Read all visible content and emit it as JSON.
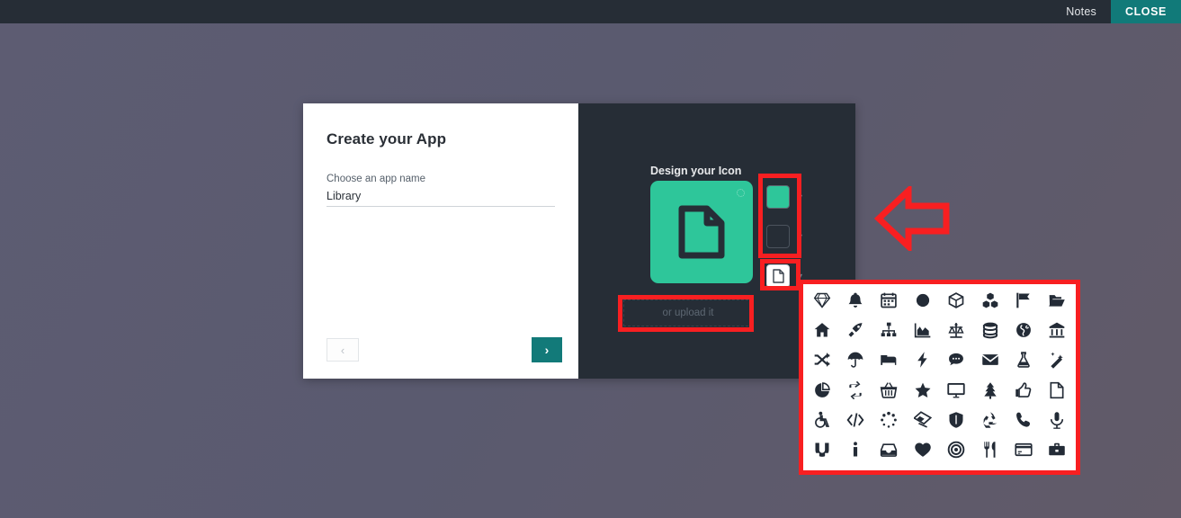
{
  "topbar": {
    "notes_label": "Notes",
    "close_label": "CLOSE",
    "close_color": "#117a79",
    "bar_color": "#262d36"
  },
  "wizard": {
    "left": {
      "title": "Create your App",
      "field_label": "Choose an app name",
      "field_value": "Library",
      "field_placeholder": "Choose an app name",
      "prev_icon": "chevron-left-icon",
      "prev_label": "‹",
      "next_icon": "chevron-right-icon",
      "next_label": "›",
      "next_color": "#127a79"
    },
    "right": {
      "title": "Design your Icon",
      "preview_bg_color": "#2ec69a",
      "preview_icon": "file-icon",
      "upload_label": "or upload it",
      "dropdowns": [
        {
          "name": "icon-background-color",
          "swatch": "filled",
          "color": "#2ec69a",
          "caret": "▼"
        },
        {
          "name": "icon-shape",
          "swatch": "empty",
          "color": "",
          "caret": "▼"
        },
        {
          "name": "icon-glyph",
          "swatch": "white",
          "color": "#ffffff",
          "caret": "▼"
        }
      ]
    }
  },
  "annotations": {
    "highlight_color": "#f81f21",
    "arrow_direction": "left",
    "boxes": [
      "color-and-shape-dropdowns",
      "icon-glyph-dropdown",
      "upload-zone",
      "icon-picker-panel"
    ]
  },
  "icon_picker": {
    "columns": 8,
    "rows": 6,
    "icons": [
      "diamond-icon",
      "bell-icon",
      "calendar-icon",
      "circle-icon",
      "cube-icon",
      "cubes-icon",
      "flag-icon",
      "folder-open-icon",
      "home-icon",
      "rocket-icon",
      "sitemap-icon",
      "area-chart-icon",
      "balance-scale-icon",
      "database-icon",
      "globe-icon",
      "bank-icon",
      "shuffle-icon",
      "umbrella-icon",
      "bed-icon",
      "bolt-icon",
      "comment-icon",
      "envelope-icon",
      "flask-icon",
      "magic-wand-icon",
      "pie-chart-icon",
      "retweet-icon",
      "basket-icon",
      "star-icon",
      "desktop-icon",
      "tree-icon",
      "thumbs-up-icon",
      "file-icon",
      "wheelchair-icon",
      "code-icon",
      "spinner-icon",
      "tickets-icon",
      "shield-icon",
      "recycle-icon",
      "phone-icon",
      "microphone-icon",
      "magnet-icon",
      "info-icon",
      "inbox-icon",
      "heart-icon",
      "bullseye-icon",
      "cutlery-icon",
      "credit-card-icon",
      "briefcase-icon"
    ]
  }
}
